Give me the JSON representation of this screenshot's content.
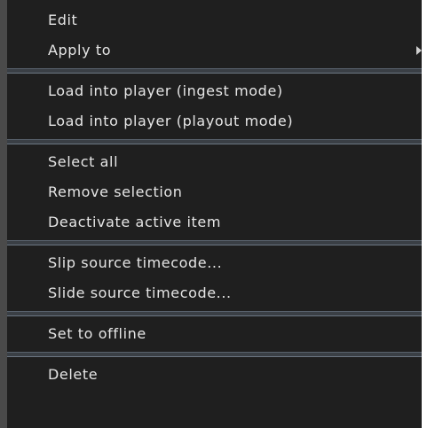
{
  "menu": {
    "items": [
      {
        "label": "Edit"
      },
      {
        "label": "Apply to"
      },
      {
        "label": "Load into player (ingest mode)"
      },
      {
        "label": "Load into player (playout mode)"
      },
      {
        "label": "Select all"
      },
      {
        "label": "Remove selection"
      },
      {
        "label": "Deactivate active item"
      },
      {
        "label": "Slip source timecode..."
      },
      {
        "label": "Slide source timecode..."
      },
      {
        "label": "Set to offline"
      },
      {
        "label": "Delete"
      }
    ]
  }
}
